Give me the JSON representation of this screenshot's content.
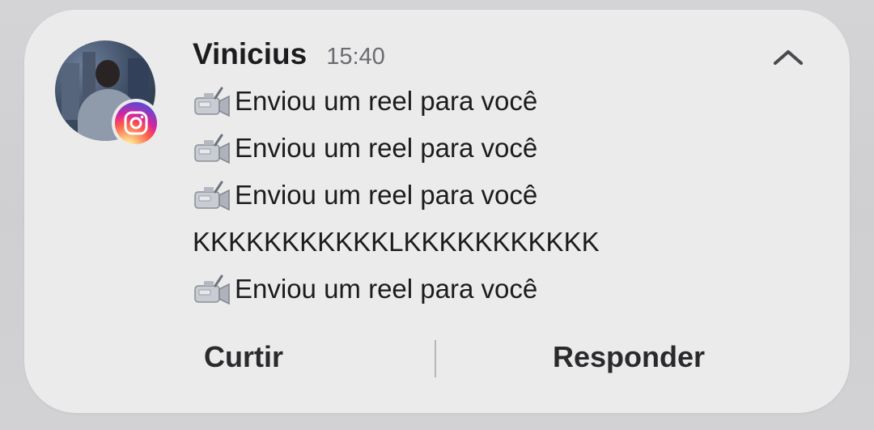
{
  "notification": {
    "sender": "Vinicius",
    "time": "15:40",
    "messages": [
      {
        "icon": "video-camera-icon",
        "text": "Enviou um reel para você"
      },
      {
        "icon": "video-camera-icon",
        "text": "Enviou um reel para você"
      },
      {
        "icon": "video-camera-icon",
        "text": "Enviou um reel para você"
      },
      {
        "icon": null,
        "text": "KKKKKKKKKKKLKKKKKKKKKKK"
      },
      {
        "icon": "video-camera-icon",
        "text": "Enviou um reel para você"
      }
    ]
  },
  "actions": {
    "like_label": "Curtir",
    "reply_label": "Responder"
  },
  "icons": {
    "app_badge": "instagram-icon",
    "collapse": "chevron-up-icon"
  },
  "colors": {
    "card_bg": "#ebebec",
    "text": "#1c1c1e",
    "time": "#6b6b70"
  }
}
